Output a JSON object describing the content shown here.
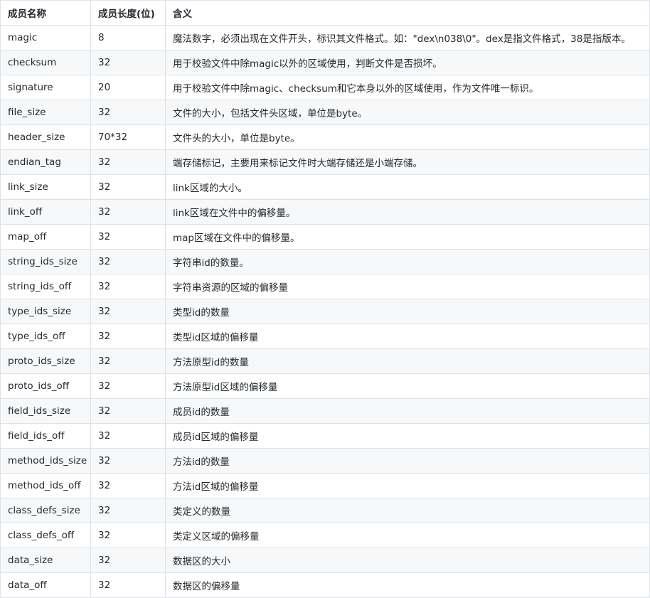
{
  "table": {
    "headers": [
      "成员名称",
      "成员长度(位)",
      "含义"
    ],
    "rows": [
      [
        "magic",
        "8",
        "魔法数字，必须出现在文件开头，标识其文件格式。如：\"dex\\n038\\0\"。dex是指文件格式，38是指版本。"
      ],
      [
        "checksum",
        "32",
        "用于校验文件中除magic以外的区域使用，判断文件是否损坏。"
      ],
      [
        "signature",
        "20",
        "用于校验文件中除magic、checksum和它本身以外的区域使用，作为文件唯一标识。"
      ],
      [
        "file_size",
        "32",
        "文件的大小，包括文件头区域，单位是byte。"
      ],
      [
        "header_size",
        "70*32",
        "文件头的大小，单位是byte。"
      ],
      [
        "endian_tag",
        "32",
        "端存储标记，主要用来标记文件时大端存储还是小端存储。"
      ],
      [
        "link_size",
        "32",
        "link区域的大小。"
      ],
      [
        "link_off",
        "32",
        "link区域在文件中的偏移量。"
      ],
      [
        "map_off",
        "32",
        "map区域在文件中的偏移量。"
      ],
      [
        "string_ids_size",
        "32",
        "字符串id的数量。"
      ],
      [
        "string_ids_off",
        "32",
        "字符串资源的区域的偏移量"
      ],
      [
        "type_ids_size",
        "32",
        "类型id的数量"
      ],
      [
        "type_ids_off",
        "32",
        "类型id区域的偏移量"
      ],
      [
        "proto_ids_size",
        "32",
        "方法原型id的数量"
      ],
      [
        "proto_ids_off",
        "32",
        "方法原型id区域的偏移量"
      ],
      [
        "field_ids_size",
        "32",
        "成员id的数量"
      ],
      [
        "field_ids_off",
        "32",
        "成员id区域的偏移量"
      ],
      [
        "method_ids_size",
        "32",
        "方法id的数量"
      ],
      [
        "method_ids_off",
        "32",
        "方法id区域的偏移量"
      ],
      [
        "class_defs_size",
        "32",
        "类定义的数量"
      ],
      [
        "class_defs_off",
        "32",
        "类定义区域的偏移量"
      ],
      [
        "data_size",
        "32",
        "数据区的大小"
      ],
      [
        "data_off",
        "32",
        "数据区的偏移量"
      ]
    ]
  }
}
